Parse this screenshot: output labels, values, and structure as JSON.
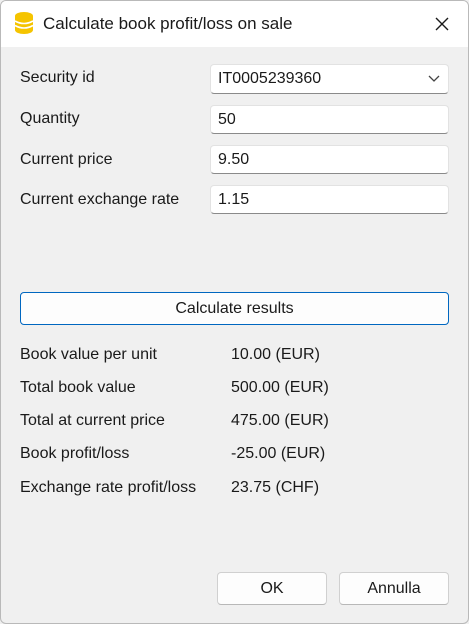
{
  "window": {
    "title": "Calculate book profit/loss on sale",
    "app_icon": "banana-app-icon",
    "accent_color": "#0067c0",
    "icon_color": "#f5c400"
  },
  "form": {
    "security_id": {
      "label": "Security id",
      "value": "IT0005239360"
    },
    "quantity": {
      "label": "Quantity",
      "value": "50"
    },
    "current_price": {
      "label": "Current price",
      "value": "9.50"
    },
    "exchange_rate": {
      "label": "Current exchange rate",
      "value": "1.15"
    }
  },
  "calculate_button": {
    "label": "Calculate results"
  },
  "results": [
    {
      "label": "Book value per unit",
      "value": "10.00 (EUR)"
    },
    {
      "label": "Total book value",
      "value": "500.00 (EUR)"
    },
    {
      "label": "Total at current price",
      "value": "475.00 (EUR)"
    },
    {
      "label": "Book profit/loss",
      "value": "-25.00 (EUR)"
    },
    {
      "label": "Exchange rate profit/loss",
      "value": "23.75 (CHF)"
    }
  ],
  "footer": {
    "ok_label": "OK",
    "cancel_label": "Annulla"
  }
}
